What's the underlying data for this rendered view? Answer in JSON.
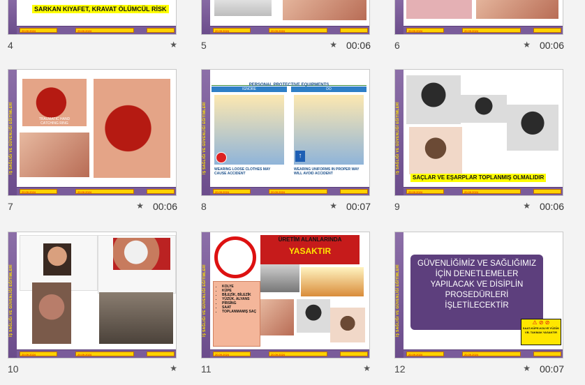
{
  "slides": [
    {
      "number": "4",
      "duration": ""
    },
    {
      "number": "5",
      "duration": "00:06"
    },
    {
      "number": "6",
      "duration": "00:06"
    },
    {
      "number": "7",
      "duration": "00:06"
    },
    {
      "number": "8",
      "duration": "00:07"
    },
    {
      "number": "9",
      "duration": "00:06"
    },
    {
      "number": "10",
      "duration": ""
    },
    {
      "number": "11",
      "duration": ""
    },
    {
      "number": "12",
      "duration": "00:07"
    }
  ],
  "strip_text": "İŞ SAĞLIĞI VE GÜVENLİĞİ EĞİTİMLERİ",
  "strip_label": "İSG",
  "footer_date": "20.09.2024",
  "slide_texts": {
    "s4_title": "SARKAN KIYAFET, KRAVAT ÖLÜMCÜL RİSK",
    "s7_caption": "TRAUMATIC HAND CATCHING RING",
    "s8_title": "PERSONAL PROTECTIVE EQUIPMENTS",
    "s8_ignore": "IGNORE",
    "s8_do": "DO",
    "s8_bad": "WEARING LOOSE CLOTHES MAY CAUSE ACCIDENT",
    "s8_good": "WEARING UNIFORMS IN PROPER WAY WILL AVOID ACCIDENT",
    "s9_caption": "SAÇLAR VE EŞARPLAR TOPLANMIŞ OLMALIDIR",
    "s11_header": "ÜRETİM ALANLARINDA",
    "s11_banned": "YASAKTIR",
    "s11_list": [
      "KOLYE",
      "KÜPE",
      "BİLEZİK, BİLEZİK",
      "YÜZÜK, ALYANS",
      "PİRSİNG",
      "SAAT",
      "TOPLANMAMIŞ SAÇ"
    ],
    "s12_text": "GÜVENLİĞİMİZ VE SAĞLIĞIMIZ İÇİN DENETLEMELER YAPILACAK VE DİSİPLİN PROSEDÜRLERİ İŞLETİLECEKTİR",
    "s12_sign": "SAAT-KÜPE-KOLYE YÜZÜK VB. TAKMAK YASAKTIR"
  },
  "icons": {
    "star": "star-icon"
  },
  "colors": {
    "strip": "#6b4c8b",
    "footer_box": "#ffd200",
    "s12_banner": "#5d3f7d"
  }
}
